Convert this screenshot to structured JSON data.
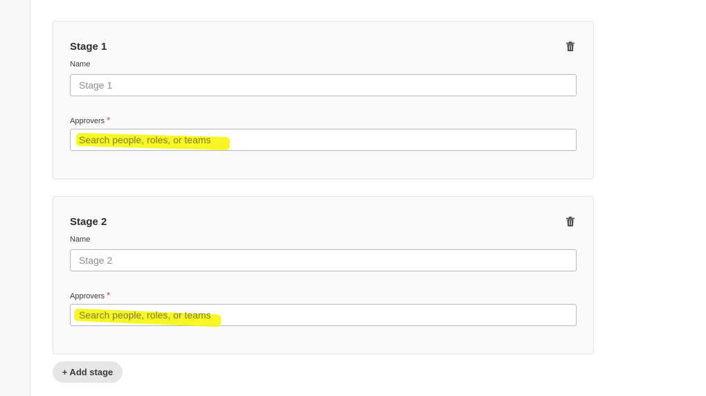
{
  "stages": [
    {
      "title": "Stage 1",
      "name_label": "Name",
      "name_placeholder": "Stage 1",
      "approvers_label": "Approvers",
      "required_mark": "*",
      "approvers_placeholder": "Search people, roles, or teams"
    },
    {
      "title": "Stage 2",
      "name_label": "Name",
      "name_placeholder": "Stage 2",
      "approvers_label": "Approvers",
      "required_mark": "*",
      "approvers_placeholder": "Search people, roles, or teams"
    }
  ],
  "add_stage_label": "+ Add stage",
  "icons": {
    "delete": "trash-icon"
  },
  "colors": {
    "highlight": "#f6f600",
    "required": "#d7373f",
    "card_bg": "#fafafa",
    "button_bg": "#e6e6e6"
  }
}
